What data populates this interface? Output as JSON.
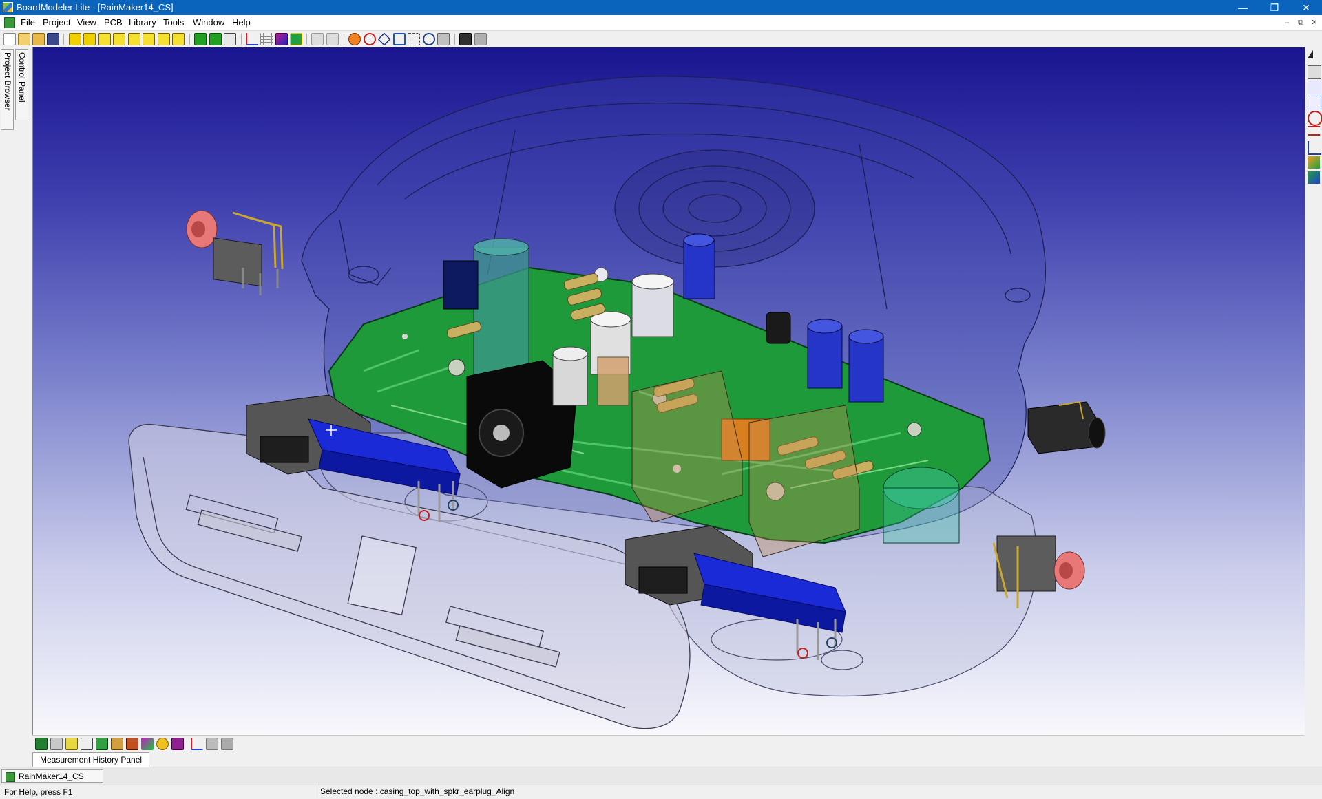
{
  "window": {
    "title": "BoardModeler Lite - [RainMaker14_CS]",
    "minimize": "—",
    "restore": "❐",
    "close": "✕"
  },
  "menu": {
    "items": [
      "File",
      "Project",
      "View",
      "PCB",
      "Library",
      "Tools",
      "Window",
      "Help"
    ],
    "mdi_min": "–",
    "mdi_restore": "⧉",
    "mdi_close": "✕"
  },
  "left_tabs": {
    "project_browser": "Project Browser",
    "control_panel": "Control Panel"
  },
  "panel": {
    "measurement_tab": "Measurement History Panel"
  },
  "document": {
    "tab": "RainMaker14_CS"
  },
  "status": {
    "help": "For Help, press F1",
    "selected": "Selected node : casing_top_with_spkr_earplug_Align"
  },
  "colors": {
    "pcb_green": "#1f9a3a",
    "connector_blue": "#1a2ad6",
    "jack_red": "#e87070",
    "casing": "#8d8fb8",
    "capacitor_blue": "#2435c8"
  },
  "icons": {
    "toolbar": [
      "new-file-icon",
      "open-icon",
      "open-folder-icon",
      "save-icon",
      "part-yellow-icon",
      "part-yellow-icon",
      "box-yellow-icon",
      "box-yellow-icon",
      "box-yellow-icon",
      "box-yellow-icon",
      "box-yellow-icon",
      "box-yellow-icon",
      "box-green-icon",
      "box-green-icon",
      "box-outline-icon",
      "axes-icon",
      "grid-icon",
      "layers-icon",
      "board-icon",
      "view-icon",
      "view-icon",
      "rotate-icon",
      "zoom-icon",
      "pan-icon",
      "fit-icon",
      "zoom-window-icon",
      "zoom-in-icon",
      "export-icon",
      "print-icon",
      "settings-icon"
    ]
  }
}
